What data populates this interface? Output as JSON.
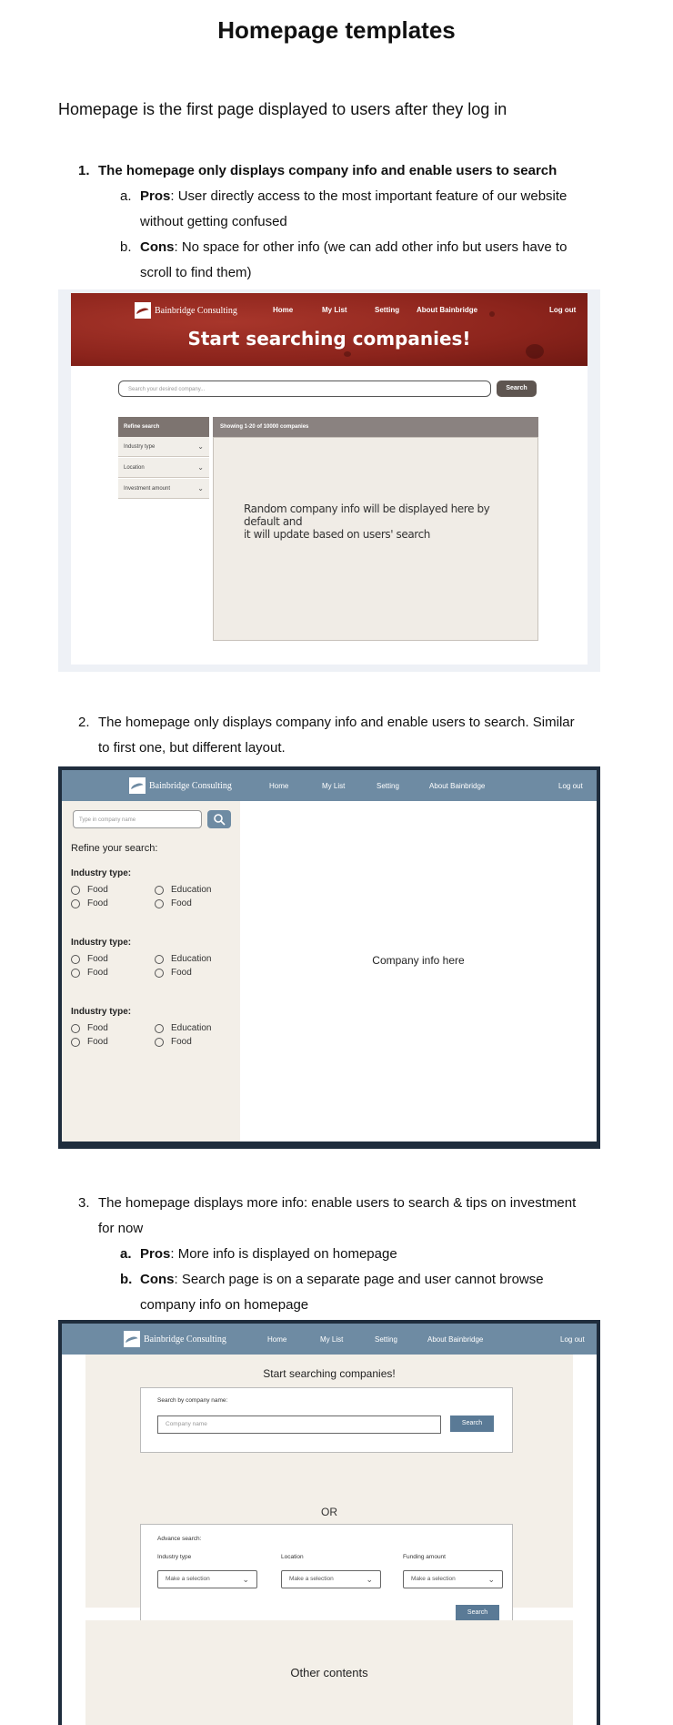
{
  "doc_title": "Homepage templates",
  "intro": "Homepage is the first page displayed to users after they log in",
  "item1": {
    "number": "1.",
    "text": "The homepage only displays company info and enable users to search",
    "pros_label": "Pros",
    "pros_line1": ": User directly access to the most important feature of our website",
    "pros_line2": "without getting confused",
    "cons_label": "Cons",
    "cons_line1": ": No space for other info (we can add other info but users have to",
    "cons_line2": "scroll to find them)",
    "a": "a.",
    "b": "b."
  },
  "mock1": {
    "brand": "Bainbridge Consulting",
    "nav": [
      "Home",
      "My List",
      "Setting",
      "About Bainbridge"
    ],
    "logout": "Log out",
    "heading": "Start searching companies!",
    "search_placeholder": "Search your desired company...",
    "search_button": "Search",
    "refine_header": "Refine search",
    "filters": [
      "Industry type",
      "Location",
      "Investment amount"
    ],
    "results_header": "Showing 1-20 of 10000 companies",
    "results_line1": "Random company info will be displayed here by default and",
    "results_line2": "it will update based on users' search"
  },
  "item2": {
    "number": "2.",
    "line1": "The homepage only displays company info and enable users to search. Similar",
    "line2": "to first one, but different layout."
  },
  "mock2": {
    "brand": "Bainbridge Consulting",
    "nav": [
      "Home",
      "My List",
      "Setting",
      "About Bainbridge"
    ],
    "logout": "Log out",
    "search_placeholder": "Type in company name",
    "refine": "Refine your search:",
    "groups": [
      {
        "label": "Industry type:",
        "opts": [
          "Food",
          "Education",
          "Food",
          "Food"
        ]
      },
      {
        "label": "Industry type:",
        "opts": [
          "Food",
          "Education",
          "Food",
          "Food"
        ]
      },
      {
        "label": "Industry type:",
        "opts": [
          "Food",
          "Education",
          "Food",
          "Food"
        ]
      }
    ],
    "company_info": "Company info here"
  },
  "item3": {
    "number": "3.",
    "line1": "The homepage displays more info: enable users to search & tips on investment",
    "line2": "for now",
    "a": "a.",
    "b": "b.",
    "pros_label": "Pros",
    "pros_text": ": More info is displayed on homepage",
    "cons_label": "Cons",
    "cons_line1": ": Search page is on a separate page and user cannot browse",
    "cons_line2": "company info on homepage"
  },
  "mock3": {
    "brand": "Bainbridge Consulting",
    "nav": [
      "Home",
      "My List",
      "Setting",
      "About Bainbridge"
    ],
    "logout": "Log out",
    "title": "Start searching companies!",
    "search_by_name": "Search by company name:",
    "company_placeholder": "Company name",
    "search_button": "Search",
    "or": "OR",
    "advance": "Advance search:",
    "labels": [
      "Industry type",
      "Location",
      "Funding amount"
    ],
    "select_text": "Make a selection",
    "search_button2": "Search",
    "other": "Other contents"
  }
}
